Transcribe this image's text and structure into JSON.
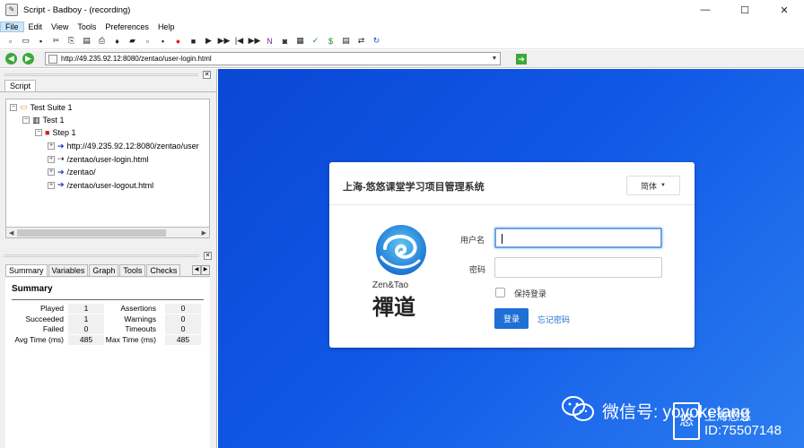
{
  "window": {
    "title": "Script - Badboy - (recording)",
    "minimize": "—",
    "maximize": "☐",
    "close": "✕"
  },
  "menu": [
    "File",
    "Edit",
    "View",
    "Tools",
    "Preferences",
    "Help"
  ],
  "toolbar_icons": [
    "new-icon",
    "open-icon",
    "save-icon",
    "cut-icon",
    "copy-icon",
    "paste-icon",
    "print-icon",
    "wand-icon",
    "folder-add-icon",
    "step-add-icon",
    "request-icon",
    "record-icon",
    "stop-icon",
    "play-icon",
    "play-all-icon",
    "step-back-icon",
    "fast-forward-icon",
    "n-icon",
    "camera-icon",
    "table-icon",
    "check-icon",
    "dollar-icon",
    "grid-icon",
    "tools-icon",
    "refresh-icon"
  ],
  "toolbar_glyphs": [
    "▫",
    "▭",
    "▪",
    "✂",
    "⎘",
    "▤",
    "⎙",
    "♦",
    "▰",
    "▫",
    "▪",
    "●",
    "■",
    "▶",
    "▶▶",
    "|◀",
    "▶▶",
    "N",
    "◙",
    "▦",
    "✓",
    "$",
    "▤",
    "⇄",
    "↻"
  ],
  "address": {
    "url": "http://49.235.92.12:8080/zentao/user-login.html"
  },
  "left_pane": {
    "tab": "Script",
    "tree": [
      {
        "label": "Test Suite 1",
        "exp": "−",
        "icon": "folder-icon",
        "glyph": "▭"
      },
      {
        "label": "Test 1",
        "exp": "−",
        "icon": "test-icon",
        "glyph": "▥"
      },
      {
        "label": "Step 1",
        "exp": "−",
        "icon": "step-icon",
        "glyph": "■"
      },
      {
        "label": "http://49.235.92.12:8080/zentao/user",
        "exp": "+",
        "icon": "request-arrow-icon",
        "glyph": "➔"
      },
      {
        "label": "/zentao/user-login.html",
        "exp": "+",
        "icon": "form-icon",
        "glyph": "⇢"
      },
      {
        "label": "/zentao/",
        "exp": "+",
        "icon": "request-arrow-icon",
        "glyph": "➔"
      },
      {
        "label": "/zentao/user-logout.html",
        "exp": "+",
        "icon": "request-arrow-icon",
        "glyph": "➔"
      }
    ],
    "bottom_tabs": [
      "Summary",
      "Variables",
      "Graph",
      "Tools",
      "Checks"
    ],
    "summary": {
      "heading": "Summary",
      "left": [
        {
          "label": "Played",
          "value": "1"
        },
        {
          "label": "Succeeded",
          "value": "1"
        },
        {
          "label": "Failed",
          "value": "0"
        },
        {
          "label": "Avg Time (ms)",
          "value": "485"
        }
      ],
      "right": [
        {
          "label": "Assertions",
          "value": "0"
        },
        {
          "label": "Warnings",
          "value": "0"
        },
        {
          "label": "Timeouts",
          "value": "0"
        },
        {
          "label": "Max Time (ms)",
          "value": "485"
        }
      ]
    }
  },
  "login": {
    "title": "上海-悠悠课堂学习项目管理系统",
    "lang": "简体",
    "username_label": "用户名",
    "password_label": "密码",
    "remember": "保持登录",
    "login_button": "登录",
    "forgot": "忘记密码",
    "logo_text": "Zen&Tao",
    "logo_cn": "禪道"
  },
  "watermark": {
    "text": "微信号: yoyoketang",
    "box": "悠",
    "small": "上海悠悠",
    "id": "ID:75507148"
  },
  "colors": {
    "web_bg": "#1057e6",
    "accent": "#1f6fd6"
  }
}
